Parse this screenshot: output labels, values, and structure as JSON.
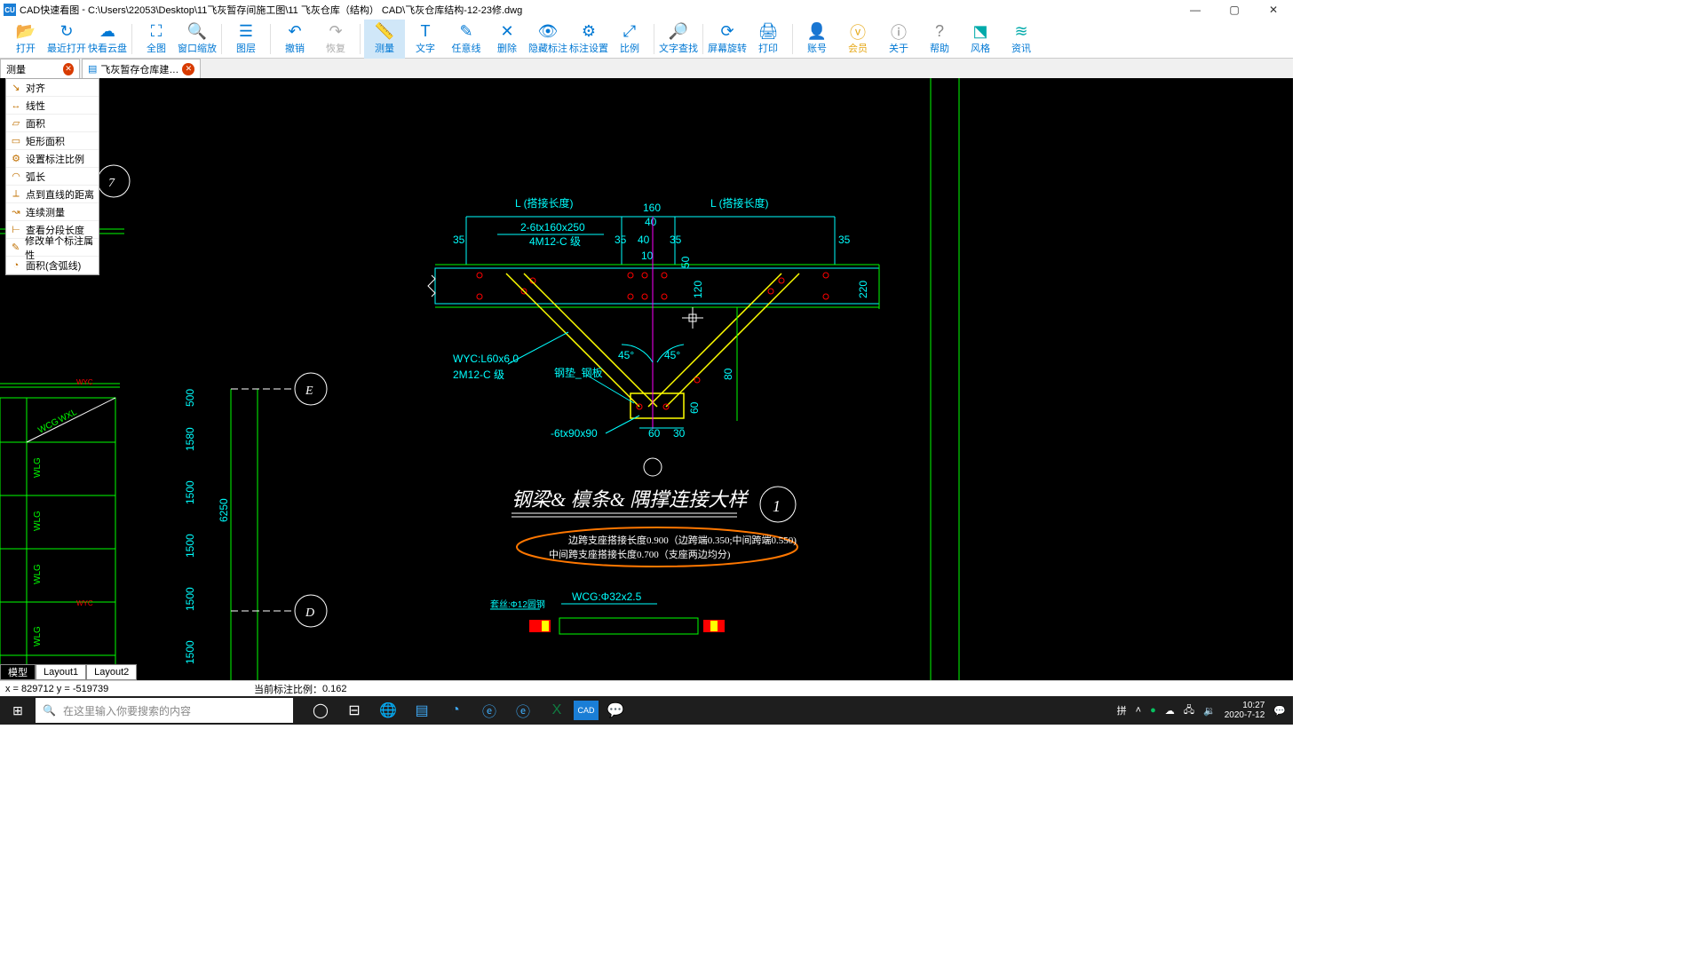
{
  "window": {
    "app_name": "CAD快速看图",
    "title_path": "C:\\Users\\22053\\Desktop\\11飞灰暂存间施工图\\11 飞灰仓库（结构） CAD\\飞灰仓库结构-12-23修.dwg",
    "min": "—",
    "max": "▢",
    "close": "✕"
  },
  "toolbar": {
    "open": "打开",
    "recent": "最近打开",
    "clouddisk": "快看云盘",
    "full": "全图",
    "zoomwin": "窗口缩放",
    "layer": "图层",
    "undo": "撤销",
    "redo": "恢复",
    "measure": "测量",
    "text": "文字",
    "freeline": "任意线",
    "delete": "删除",
    "hideannot": "隐藏标注",
    "annotset": "标注设置",
    "scale": "比例",
    "textfind": "文字查找",
    "screenrot": "屏幕旋转",
    "print": "打印",
    "account": "账号",
    "vip": "会员",
    "about": "关于",
    "help": "帮助",
    "style": "风格",
    "news": "资讯"
  },
  "tabs": {
    "input_value": "测量",
    "file_tab": "飞灰暂存仓库建…"
  },
  "measure_menu": {
    "items": [
      "对齐",
      "线性",
      "面积",
      "矩形面积",
      "设置标注比例",
      "弧长",
      "点到直线的距离",
      "连续测量",
      "查看分段长度",
      "修改单个标注属性",
      "面积(含弧线)"
    ]
  },
  "drawing": {
    "dims": {
      "L_left": "L (搭接长度)",
      "L_right": "L (搭接长度)",
      "d160": "160",
      "d40": "40",
      "spec1": "2-6tx160x250",
      "spec2": "4M12-C 级",
      "d35a": "35",
      "d35b": "35",
      "d40b": "40",
      "d35c": "35",
      "d35d": "35",
      "d10": "10",
      "d50": "50",
      "d120": "120",
      "d220": "220",
      "wyc1": "WYC:L60x6.0",
      "wyc2": "2M12-C 级",
      "steel": "钢垫_钢板",
      "ang45a": "45°",
      "ang45b": "45°",
      "d80": "80",
      "d60_2": "60",
      "spec3": "-6tx90x90",
      "d60": "60",
      "d30": "30"
    },
    "title": "钢梁& 檩条& 隅撑连接大样",
    "node1": "1",
    "note1": "边跨支座搭接长度0.900（边跨端0.350;中间跨端0.550)",
    "note2": "中间跨支座搭接长度0.700（支座两边均分)",
    "wcg": "WCG:Φ32x2.5",
    "pipe_label": "套丝:Φ12圆钢",
    "side_WYC": "WYC",
    "side_WCG": "WCG",
    "side_WXL": "WXL",
    "side_WLG": "WLG",
    "grid_500": "500",
    "grid_1580": "1580",
    "grid_1500": "1500",
    "grid_6250": "6250",
    "axis_7": "7",
    "axis_E": "E",
    "axis_D": "D"
  },
  "layout_tabs": {
    "model": "模型",
    "l1": "Layout1",
    "l2": "Layout2"
  },
  "status": {
    "coords": "x = 829712  y = -519739",
    "scale_label": "当前标注比例：",
    "scale_val": "0.162"
  },
  "taskbar": {
    "search_placeholder": "在这里输入你要搜索的内容",
    "time": "10:27",
    "date": "2020-7-12"
  }
}
